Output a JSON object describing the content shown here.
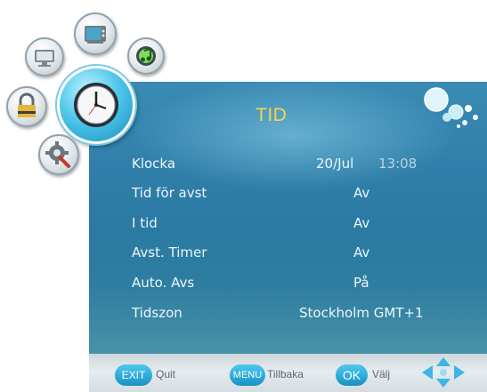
{
  "menu": {
    "title": "TID",
    "items": [
      {
        "label": "Klocka",
        "value": "20/Jul",
        "time": "13:08"
      },
      {
        "label": "Tid för avst",
        "value": "Av"
      },
      {
        "label": "I tid",
        "value": "Av"
      },
      {
        "label": "Avst. Timer",
        "value": "Av"
      },
      {
        "label": "Auto. Avs",
        "value": "På"
      },
      {
        "label": "Tidszon",
        "value": "Stockholm GMT+1"
      }
    ]
  },
  "categories": [
    {
      "name": "picture",
      "icon": "monitor-icon"
    },
    {
      "name": "channel",
      "icon": "tv-icon"
    },
    {
      "name": "sound",
      "icon": "music-note-icon"
    },
    {
      "name": "lock",
      "icon": "padlock-icon"
    },
    {
      "name": "time",
      "icon": "clock-icon",
      "active": true
    },
    {
      "name": "setup",
      "icon": "gear-wrench-icon"
    }
  ],
  "bottom_bar": {
    "exit_key": "EXIT",
    "exit_label": "Quit",
    "menu_key": "MENU",
    "menu_label": "Tillbaka",
    "ok_key": "OK",
    "ok_label": "Välj"
  },
  "colors": {
    "title": "#f4d44a",
    "panel": "#2f7ea9",
    "text": "#eef6fa",
    "accent": "#2aa8d8"
  }
}
